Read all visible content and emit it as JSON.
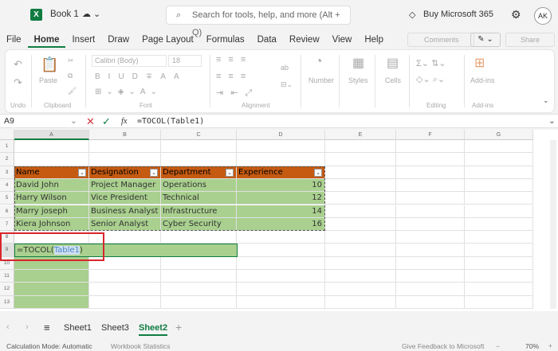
{
  "app": {
    "title": "Book 1",
    "search_placeholder": "Search for tools, help, and more (Alt + Q)",
    "buy": "Buy Microsoft 365",
    "avatar": "AK"
  },
  "menu": [
    "File",
    "Home",
    "Insert",
    "Draw",
    "Page Layout",
    "Formulas",
    "Data",
    "Review",
    "View",
    "Help"
  ],
  "menu_right": {
    "comments": "Comments",
    "share": "Share"
  },
  "ribbon": {
    "font": "Calibri (Body)",
    "size": "18",
    "paste": "Paste",
    "number": "Number",
    "styles": "Styles",
    "cells": "Cells",
    "addins": "Add-ins",
    "groups": {
      "undo": "Undo",
      "clipboard": "Clipboard",
      "font": "Font",
      "alignment": "Alignment",
      "editing": "Editing",
      "addins": "Add-ins"
    }
  },
  "formula_bar": {
    "name_box": "A9",
    "formula": "=TOCOL(Table1)"
  },
  "columns": [
    "A",
    "B",
    "C",
    "D",
    "E",
    "F",
    "G"
  ],
  "rows": [
    "1",
    "2",
    "3",
    "4",
    "5",
    "6",
    "7",
    "8",
    "9",
    "10",
    "11",
    "12",
    "13"
  ],
  "table": {
    "headers": [
      "Name",
      "Designation",
      "Department",
      "Experience"
    ],
    "rows": [
      [
        "David John",
        "Project Manager",
        "Operations",
        "10"
      ],
      [
        "Harry Wilson",
        "Vice President",
        "Technical",
        "12"
      ],
      [
        "Marry joseph",
        "Business Analyst",
        "Infrastructure",
        "14"
      ],
      [
        "Kiera Johnson",
        "Senior Analyst",
        "Cyber Security",
        "16"
      ]
    ]
  },
  "edit_cell": {
    "prefix": "=TOCOL(",
    "ref": "Table1",
    "suffix": ")"
  },
  "sheets": [
    "Sheet1",
    "Sheet3",
    "Sheet2"
  ],
  "active_sheet": "Sheet2",
  "status": {
    "calc": "Calculation Mode: Automatic",
    "stats": "Workbook Statistics",
    "feedback": "Give Feedback to Microsoft",
    "zoom": "70%"
  },
  "colors": {
    "accent": "#107c41",
    "header": "#c55a11",
    "body": "#a9d08e",
    "highlight": "#d9262b"
  }
}
